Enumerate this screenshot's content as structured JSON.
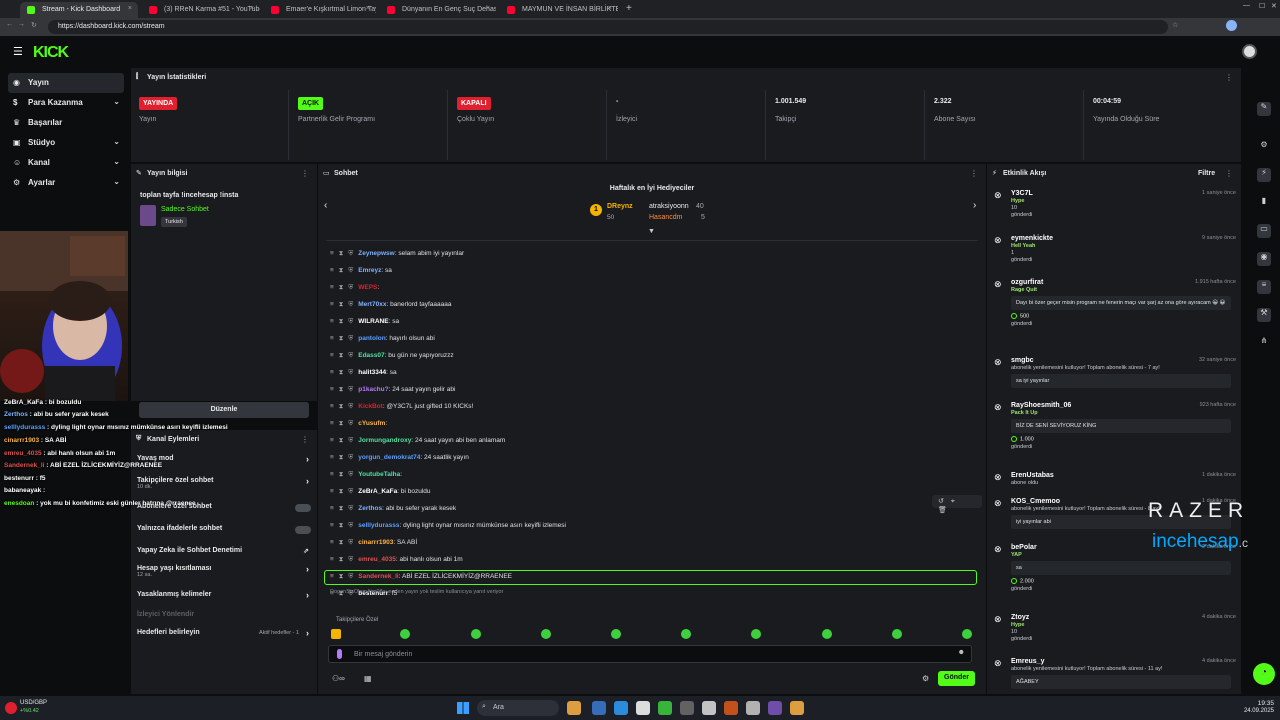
{
  "browser": {
    "tabs": [
      {
        "title": "Stream - Kick Dashboard",
        "color": "#53fc18"
      },
      {
        "title": "(3) RReN Karma #51 - YouTube",
        "color": "#ff0033"
      },
      {
        "title": "Emaer'e Kışkırtmal Limon Tayfa à",
        "color": "#ff0033"
      },
      {
        "title": "Dünyanın En Genç Suç Dehası|ğ",
        "color": "#ff0033"
      },
      {
        "title": "MAYMUN VE İNSAN BİRLİKTE BÜ",
        "color": "#ff0033"
      }
    ],
    "url": "https://dashboard.kick.com/stream"
  },
  "brand": {
    "logo": "KICK"
  },
  "sidebar": {
    "items": [
      {
        "label": "Yayın",
        "icon": "broadcast-icon",
        "active": true
      },
      {
        "label": "Para Kazanma",
        "icon": "money-icon",
        "chevron": true
      },
      {
        "label": "Başarılar",
        "icon": "trophy-icon"
      },
      {
        "label": "Stüdyo",
        "icon": "camera-icon",
        "chevron": true
      },
      {
        "label": "Kanal",
        "icon": "user-icon",
        "chevron": true
      },
      {
        "label": "Ayarlar",
        "icon": "gear-icon",
        "chevron": true
      }
    ]
  },
  "stats": {
    "title": "Yayın İstatistikleri",
    "cells": [
      {
        "value": "YAYINDA",
        "label": "Yayın",
        "badge": true,
        "badge_color": "#e0202e",
        "badge_text_color": "#ffffff"
      },
      {
        "value": "AÇIK",
        "label": "Partnerlik Gelir Programı",
        "badge": true,
        "badge_color": "#53fc18",
        "badge_text_color": "#0b0d0f"
      },
      {
        "value": "KAPALI",
        "label": "Çoklu Yayın",
        "badge": true,
        "badge_color": "#e0202e",
        "badge_text_color": "#ffffff"
      },
      {
        "value": "-",
        "label": "İzleyici",
        "badge": false
      },
      {
        "value": "1.001.549",
        "label": "Takipçi",
        "badge": false
      },
      {
        "value": "2.322",
        "label": "Abone Sayısı",
        "badge": false
      },
      {
        "value": "00:04:59",
        "label": "Yayında Olduğu Süre",
        "badge": false
      }
    ]
  },
  "stream_info": {
    "title": "Yayın bilgisi",
    "stream_title": "toplan tayfa !incehesap !insta",
    "category": "Sadece Sohbet",
    "tag": "Turkish",
    "edit_button": "Düzenle"
  },
  "channel_actions": {
    "title": "Kanal Eylemleri",
    "items": [
      {
        "label": "Yavaş mod",
        "type": "chevron"
      },
      {
        "label": "Takipçilere özel sohbet",
        "sub": "10 dk.",
        "type": "chevron"
      },
      {
        "label": "Abonelere özel sohbet",
        "type": "toggle"
      },
      {
        "label": "Yalnızca ifadelerle sohbet",
        "type": "toggle"
      },
      {
        "label": "Yapay Zeka ile Sohbet Denetimi",
        "type": "link"
      },
      {
        "label": "Hesap yaşı kısıtlaması",
        "sub": "12 sa.",
        "type": "chevron"
      },
      {
        "label": "Yasaklanmış kelimeler",
        "type": "chevron"
      },
      {
        "label": "İzleyici Yönlendir",
        "type": "disabled"
      },
      {
        "label": "Hedefleri belirleyin",
        "extra": "Aktif hedefler - 1",
        "type": "chevron"
      }
    ]
  },
  "overlay_chat": [
    {
      "user": "ZeBrA_KaFa",
      "text": "bi bozuldu",
      "color": "#ffffff"
    },
    {
      "user": "Zerthos",
      "text": "abi bu sefer yarak kesek",
      "color": "#7fb3ff"
    },
    {
      "user": "selllydurasss",
      "text": "dyling light oynar mısınız mümkünse asırı keyifli izlemesi",
      "color": "#5aa0ff"
    },
    {
      "user": "cinarrr1903",
      "text": "SA ABİ",
      "color": "#ffb545"
    },
    {
      "user": "emreu_4035",
      "text": "abi hanlı olsun abi 1m",
      "color": "#e05050"
    },
    {
      "user": "Sandernek_li",
      "text": "ABİ EZEL İZLİCEKMİYİZ@RRAENEE",
      "color": "#e05050"
    },
    {
      "user": "bestenurr",
      "text": "f5",
      "color": "#ffffff"
    },
    {
      "user": "babaneayak",
      "text": "",
      "color": "#ffffff"
    },
    {
      "user": "enesdoan",
      "text": "yok mu bi konfetimiz eski günler hatrına @rraenee",
      "color": "#53fc18"
    }
  ],
  "chat": {
    "title": "Sohbet",
    "top_gifters": {
      "title": "Haftalık en İyi Hediyeciler",
      "first": {
        "name": "DReynz",
        "amount": "50"
      },
      "others": [
        {
          "name": "atraksiyoonn",
          "amount": "40"
        },
        {
          "name": "Hasancdm",
          "amount": "5"
        }
      ]
    },
    "messages": [
      {
        "user": "Zeynepwsw",
        "text": "selam abim iyi yayınlar",
        "color": "#7fb3ff"
      },
      {
        "user": "Emreyz",
        "text": "sa",
        "color": "#7fb3ff"
      },
      {
        "user": "WEPS",
        "text": "",
        "color": "#e0202e"
      },
      {
        "user": "Mert70xx",
        "text": "banerlord tayfaaaaaa",
        "color": "#7fb3ff"
      },
      {
        "user": "WILRANE",
        "text": "sa",
        "color": "#ffffff"
      },
      {
        "user": "pantolon",
        "text": "hayırlı olsun abi",
        "color": "#5aa0ff"
      },
      {
        "user": "Edass07",
        "text": "bu gün ne yapıyoruzzz",
        "color": "#53e0a0"
      },
      {
        "user": "halit3344",
        "text": "sa",
        "color": "#ffffff"
      },
      {
        "user": "p1kachu?",
        "text": "24 saat yayın gelir abi",
        "color": "#b47aff"
      },
      {
        "user": "KickBot",
        "text": "@Y3C7L just gifted 10 KICKs!",
        "color": "#e0202e"
      },
      {
        "user": "cYusufm",
        "text": "",
        "color": "#ffb545"
      },
      {
        "user": "Jormungandroxy",
        "text": "24 saat yayın abi ben anlamam",
        "color": "#53e0a0"
      },
      {
        "user": "yorgun_demokrat74",
        "text": "24 saatlik yayın",
        "color": "#5aa0ff"
      },
      {
        "user": "YoutubeTalha",
        "text": "",
        "color": "#53e0a0"
      },
      {
        "user": "ZeBrA_KaFa",
        "text": "bi bozuldu",
        "color": "#ffffff"
      },
      {
        "user": "Zerthos",
        "text": "abi bu sefer yarak kesek",
        "color": "#7fb3ff"
      },
      {
        "user": "selllydurasss",
        "text": "dyling light oynar mısınız mümkünse asırı keyifli izlemesi",
        "color": "#5aa0ff"
      },
      {
        "user": "cinarrr1903",
        "text": "SA ABİ",
        "color": "#ffb545"
      },
      {
        "user": "emreu_4035",
        "text": "abi hanlı olsun abi 1m",
        "color": "#e05050"
      },
      {
        "user": "Sandernek_li",
        "text": "ABİ EZEL İZLİCEKMİYİZ@RRAENEE",
        "color": "#e05050",
        "highlight": true
      },
      {
        "user": "bestenurr",
        "text": "f5",
        "color": "#ffffff"
      }
    ],
    "reply_note": "DoganSisOlamAim08x: neden yayın yok teslim kullanıcıya yanıt veriyor",
    "follower_only": "Takipçilere Özel",
    "input_placeholder": "Bir mesaj gönderin",
    "send_button": "Gönder"
  },
  "events": {
    "title": "Etkinlik Akışı",
    "filter": "Filtre",
    "items": [
      {
        "name": "Y3C7L",
        "time": "1 saniye önce",
        "lines": [
          "Hype",
          "10",
          "gönderdi"
        ]
      },
      {
        "name": "eymenkickte",
        "time": "9 saniye önce",
        "lines": [
          "Hell Yeah",
          "1",
          "gönderdi"
        ]
      },
      {
        "name": "ozgurfirat",
        "time": "1.915 hafta önce",
        "lines": [
          "Rage Quit"
        ],
        "box": "Dayı bi özer geçer misin program ne fenerin maçı var şarj az ona göre ayıracam 😀 😀",
        "amount": "500",
        "after": "gönderdi"
      },
      {
        "name": "smgbc",
        "time": "32 saniye önce",
        "lines": [
          "abonelik yenilemesini kutluyor! Toplam abonelik süresi - 7 ay!"
        ],
        "box": "sa iyi yayınlar"
      },
      {
        "name": "RayShoesmith_06",
        "time": "923 hafta önce",
        "lines": [
          "Pack It Up"
        ],
        "box": "BİZ DE SENİ SEVİYORUZ KİNG",
        "amount": "1.000",
        "after": "gönderdi"
      },
      {
        "name": "ErenUstabas",
        "time": "1 dakika önce",
        "lines": [
          "abone oldu"
        ]
      },
      {
        "name": "KOS_Cmemoo",
        "time": "1 dakika önce",
        "lines": [
          "abonelik yenilemesini kutluyor! Toplam abonelik süresi - 8 ay!"
        ],
        "box": "iyi yayınlar abi"
      },
      {
        "name": "bePolar",
        "time": "2 dakika önce",
        "lines": [
          "YAP"
        ],
        "box": "sa",
        "amount": "2.000",
        "after": "gönderdi"
      },
      {
        "name": "Ztoyz",
        "time": "4 dakika önce",
        "lines": [
          "Hype",
          "10",
          "gönderdi"
        ]
      },
      {
        "name": "Emreus_y",
        "time": "4 dakika önce",
        "lines": [
          "abonelik yenilemesini kutluyor! Toplam abonelik süresi - 11 ay!"
        ],
        "box": "AĞABEY"
      }
    ]
  },
  "watermark": {
    "razer": "RAZER",
    "brand": "incehesap",
    "tld": ".com"
  },
  "taskbar": {
    "ticker": "USD/GBP",
    "ticker_change": "+%0.42",
    "search": "Ara",
    "time": "19:35",
    "date": "24.09.2025"
  }
}
